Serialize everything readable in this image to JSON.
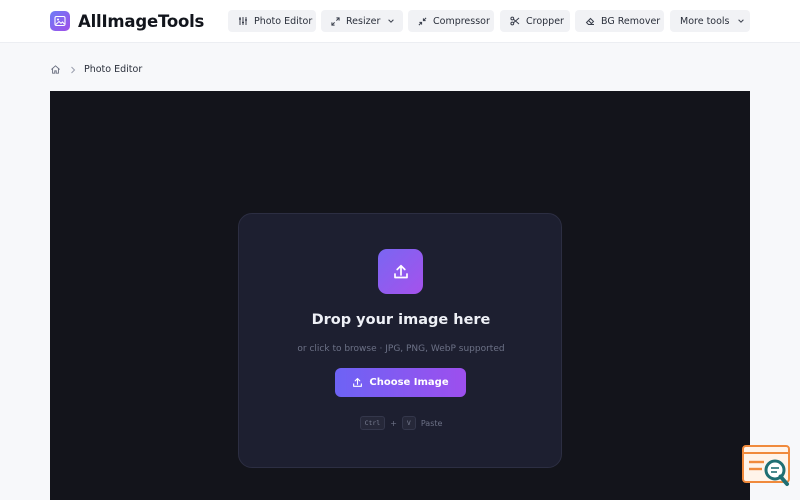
{
  "brand": {
    "name": "AllImageTools"
  },
  "nav": {
    "items": [
      {
        "label": "Photo Editor",
        "icon": "sliders-icon"
      },
      {
        "label": "Resizer",
        "icon": "expand-arrows-icon",
        "has_dropdown": true
      },
      {
        "label": "Compressor",
        "icon": "compress-arrows-icon"
      },
      {
        "label": "Cropper",
        "icon": "scissors-icon"
      },
      {
        "label": "BG Remover",
        "icon": "eraser-icon"
      },
      {
        "label": "More tools",
        "has_dropdown": true
      }
    ]
  },
  "breadcrumb": {
    "home_icon": "home-icon",
    "current": "Photo Editor"
  },
  "dropzone": {
    "title": "Drop your image here",
    "subtitle": "or click to browse · JPG, PNG, WebP supported",
    "button_label": "Choose Image",
    "shortcut": {
      "key1": "Ctrl",
      "plus": "+",
      "key2": "V",
      "action": "Paste"
    }
  },
  "colors": {
    "accent_start": "#6d63f4",
    "accent_end": "#9d4fee",
    "stage_bg": "#13141b",
    "card_bg": "#1d1f30",
    "widget_orange": "#f08a3c",
    "widget_teal": "#1f6f73"
  }
}
